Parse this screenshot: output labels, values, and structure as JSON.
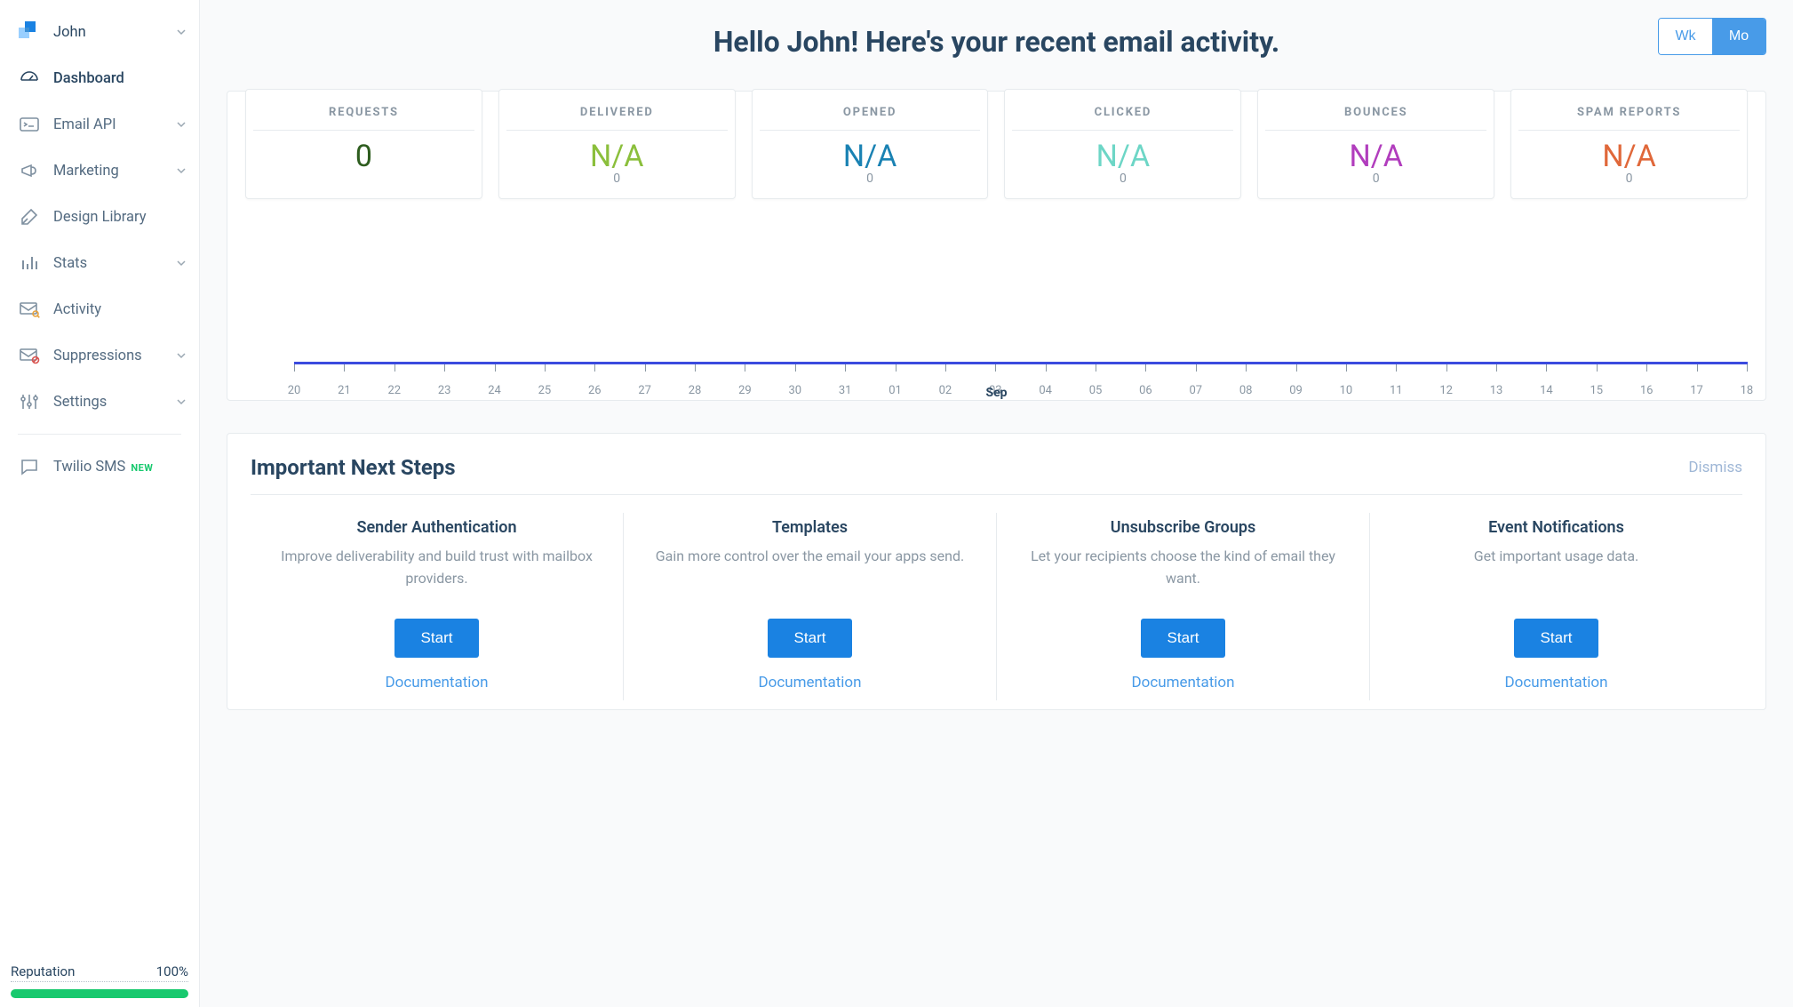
{
  "sidebar": {
    "user": "John",
    "items": [
      {
        "label": "Dashboard"
      },
      {
        "label": "Email API"
      },
      {
        "label": "Marketing"
      },
      {
        "label": "Design Library"
      },
      {
        "label": "Stats"
      },
      {
        "label": "Activity"
      },
      {
        "label": "Suppressions"
      },
      {
        "label": "Settings"
      },
      {
        "label": "Twilio SMS"
      }
    ],
    "new_badge": "NEW",
    "reputation": {
      "label": "Reputation",
      "value": "100%",
      "pct": 100
    }
  },
  "headline": "Hello John! Here's your recent email activity.",
  "period": {
    "wk": "Wk",
    "mo": "Mo",
    "active": "mo"
  },
  "stats": [
    {
      "label": "REQUESTS",
      "big": "0",
      "small": "",
      "color": "#2e5d1f"
    },
    {
      "label": "DELIVERED",
      "big": "N/A",
      "small": "0",
      "color": "#8bbf3c"
    },
    {
      "label": "OPENED",
      "big": "N/A",
      "small": "0",
      "color": "#1a82b3"
    },
    {
      "label": "CLICKED",
      "big": "N/A",
      "small": "0",
      "color": "#6dd6c6"
    },
    {
      "label": "BOUNCES",
      "big": "N/A",
      "small": "0",
      "color": "#b13dbd"
    },
    {
      "label": "SPAM REPORTS",
      "big": "N/A",
      "small": "0",
      "color": "#e0683a"
    }
  ],
  "chart": {
    "ticks": [
      "20",
      "21",
      "22",
      "23",
      "24",
      "25",
      "26",
      "27",
      "28",
      "29",
      "30",
      "31",
      "01",
      "02",
      "03",
      "04",
      "05",
      "06",
      "07",
      "08",
      "09",
      "10",
      "11",
      "12",
      "13",
      "14",
      "15",
      "16",
      "17",
      "18"
    ],
    "month": "Sep"
  },
  "steps": {
    "title": "Important Next Steps",
    "dismiss": "Dismiss",
    "cards": [
      {
        "title": "Sender Authentication",
        "desc": "Improve deliverability and build trust with mailbox providers.",
        "btn": "Start",
        "doc": "Documentation"
      },
      {
        "title": "Templates",
        "desc": "Gain more control over the email your apps send.",
        "btn": "Start",
        "doc": "Documentation"
      },
      {
        "title": "Unsubscribe Groups",
        "desc": "Let your recipients choose the kind of email they want.",
        "btn": "Start",
        "doc": "Documentation"
      },
      {
        "title": "Event Notifications",
        "desc": "Get important usage data.",
        "btn": "Start",
        "doc": "Documentation"
      }
    ]
  },
  "chart_data": {
    "type": "line",
    "x": [
      "20",
      "21",
      "22",
      "23",
      "24",
      "25",
      "26",
      "27",
      "28",
      "29",
      "30",
      "31",
      "01",
      "02",
      "03",
      "04",
      "05",
      "06",
      "07",
      "08",
      "09",
      "10",
      "11",
      "12",
      "13",
      "14",
      "15",
      "16",
      "17",
      "18"
    ],
    "series": [
      {
        "name": "Requests",
        "values": [
          0,
          0,
          0,
          0,
          0,
          0,
          0,
          0,
          0,
          0,
          0,
          0,
          0,
          0,
          0,
          0,
          0,
          0,
          0,
          0,
          0,
          0,
          0,
          0,
          0,
          0,
          0,
          0,
          0,
          0
        ]
      },
      {
        "name": "Delivered",
        "values": [
          0,
          0,
          0,
          0,
          0,
          0,
          0,
          0,
          0,
          0,
          0,
          0,
          0,
          0,
          0,
          0,
          0,
          0,
          0,
          0,
          0,
          0,
          0,
          0,
          0,
          0,
          0,
          0,
          0,
          0
        ]
      },
      {
        "name": "Opened",
        "values": [
          0,
          0,
          0,
          0,
          0,
          0,
          0,
          0,
          0,
          0,
          0,
          0,
          0,
          0,
          0,
          0,
          0,
          0,
          0,
          0,
          0,
          0,
          0,
          0,
          0,
          0,
          0,
          0,
          0,
          0
        ]
      },
      {
        "name": "Clicked",
        "values": [
          0,
          0,
          0,
          0,
          0,
          0,
          0,
          0,
          0,
          0,
          0,
          0,
          0,
          0,
          0,
          0,
          0,
          0,
          0,
          0,
          0,
          0,
          0,
          0,
          0,
          0,
          0,
          0,
          0,
          0
        ]
      },
      {
        "name": "Bounces",
        "values": [
          0,
          0,
          0,
          0,
          0,
          0,
          0,
          0,
          0,
          0,
          0,
          0,
          0,
          0,
          0,
          0,
          0,
          0,
          0,
          0,
          0,
          0,
          0,
          0,
          0,
          0,
          0,
          0,
          0,
          0
        ]
      },
      {
        "name": "Spam Reports",
        "values": [
          0,
          0,
          0,
          0,
          0,
          0,
          0,
          0,
          0,
          0,
          0,
          0,
          0,
          0,
          0,
          0,
          0,
          0,
          0,
          0,
          0,
          0,
          0,
          0,
          0,
          0,
          0,
          0,
          0,
          0
        ]
      }
    ],
    "xlabel": "Sep",
    "ylabel": "",
    "title": "",
    "ylim": [
      0,
      1
    ]
  }
}
